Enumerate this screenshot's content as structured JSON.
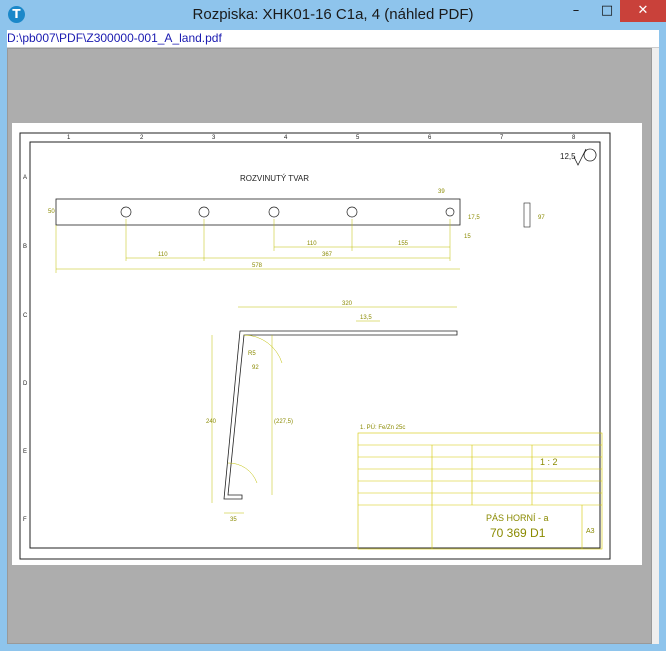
{
  "window": {
    "title": "Rozpiska: XHK01-16 C1a, 4 (náhled PDF)",
    "minimize_glyph": "–",
    "maximize_glyph": "□",
    "close_glyph": "✕",
    "app_icon": "T"
  },
  "viewer": {
    "file_path": "D:\\pb007\\PDF\\Z300000-001_A_land.pdf"
  },
  "drawing": {
    "col_numbers": [
      "1",
      "2",
      "3",
      "4",
      "5",
      "6",
      "7",
      "8"
    ],
    "row_letters": [
      "A",
      "B",
      "C",
      "D",
      "E",
      "F"
    ],
    "unfolded_label": "ROZVINUTÝ TVAR",
    "surface_finish": "12,5",
    "dim_110a": "110",
    "dim_367": "367",
    "dim_578": "578",
    "dim_110b": "110",
    "dim_155": "155",
    "dim_320": "320",
    "dim_13_5": "13,5",
    "dim_240": "240",
    "dim_227_5": "(227,5)",
    "dim_35": "35",
    "dim_50": "50",
    "dim_15": "15",
    "dim_17_5": "17,5",
    "dim_39": "39",
    "dim_R5": "R5",
    "dim_92": "92",
    "dim_97": "97",
    "coating_note": "1. PÚ: Fe/Zn 25c",
    "part_name": "PÁS HORNÍ - a",
    "part_number": "70 369 D1",
    "scale": "1 : 2",
    "sheet_size": "A3"
  }
}
